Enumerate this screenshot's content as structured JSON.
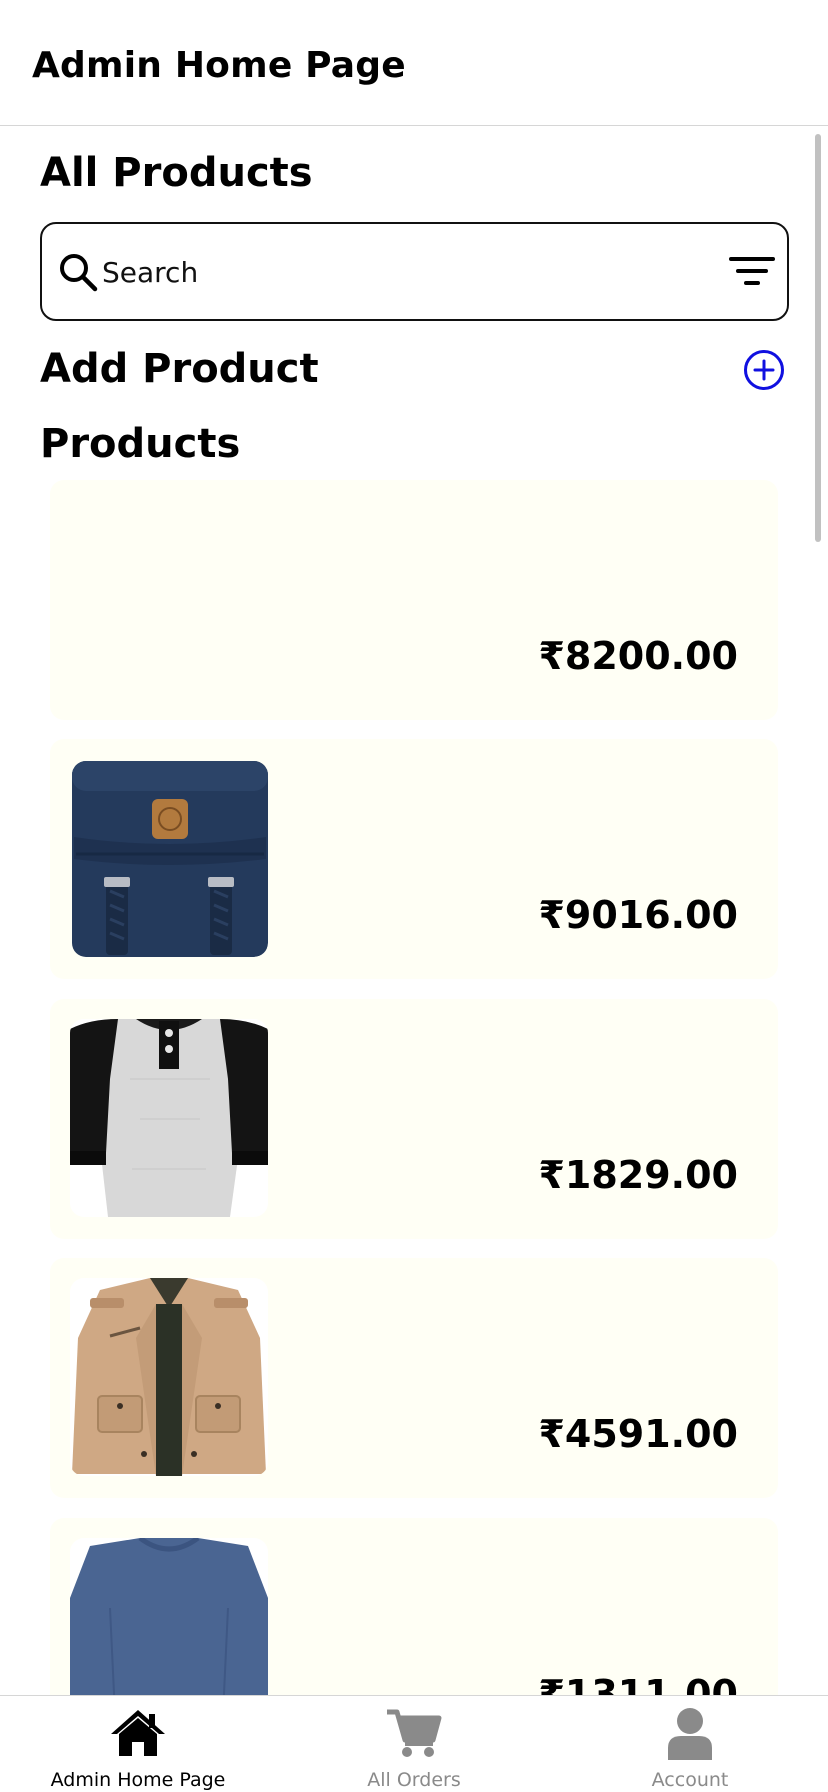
{
  "header": {
    "title": "Admin Home Page"
  },
  "main": {
    "all_products_title": "All Products",
    "search": {
      "placeholder": "Search",
      "value": ""
    },
    "add_product_label": "Add Product",
    "products_title": "Products",
    "products": [
      {
        "price": "₹8200.00",
        "image": "none"
      },
      {
        "price": "₹9016.00",
        "image": "navy-backpack"
      },
      {
        "price": "₹1829.00",
        "image": "raglan-tshirt"
      },
      {
        "price": "₹4591.00",
        "image": "khaki-jacket"
      },
      {
        "price": "₹1311.00",
        "image": "blue-sweater"
      }
    ]
  },
  "bottom_nav": {
    "items": [
      {
        "label": "Admin Home Page",
        "icon": "home-icon",
        "active": true
      },
      {
        "label": "All Orders",
        "icon": "cart-icon",
        "active": false
      },
      {
        "label": "Account",
        "icon": "user-icon",
        "active": false
      }
    ]
  },
  "colors": {
    "card_background": "#fffff5",
    "accent": "#1010e0",
    "nav_active": "#000000",
    "nav_inactive": "#8a8a8a"
  }
}
